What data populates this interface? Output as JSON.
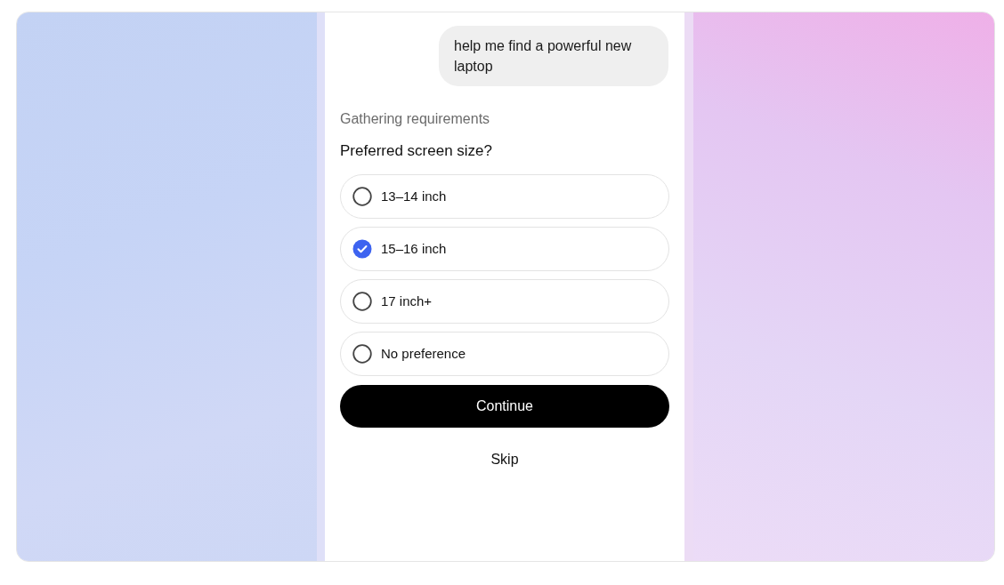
{
  "chat": {
    "user_message": "help me find a powerful new laptop"
  },
  "status": "Gathering requirements",
  "question": "Preferred screen size?",
  "options": [
    {
      "label": "13–14 inch",
      "selected": false
    },
    {
      "label": "15–16 inch",
      "selected": true
    },
    {
      "label": "17 inch+",
      "selected": false
    },
    {
      "label": "No preference",
      "selected": false
    }
  ],
  "primary_button": "Continue",
  "secondary_button": "Skip"
}
